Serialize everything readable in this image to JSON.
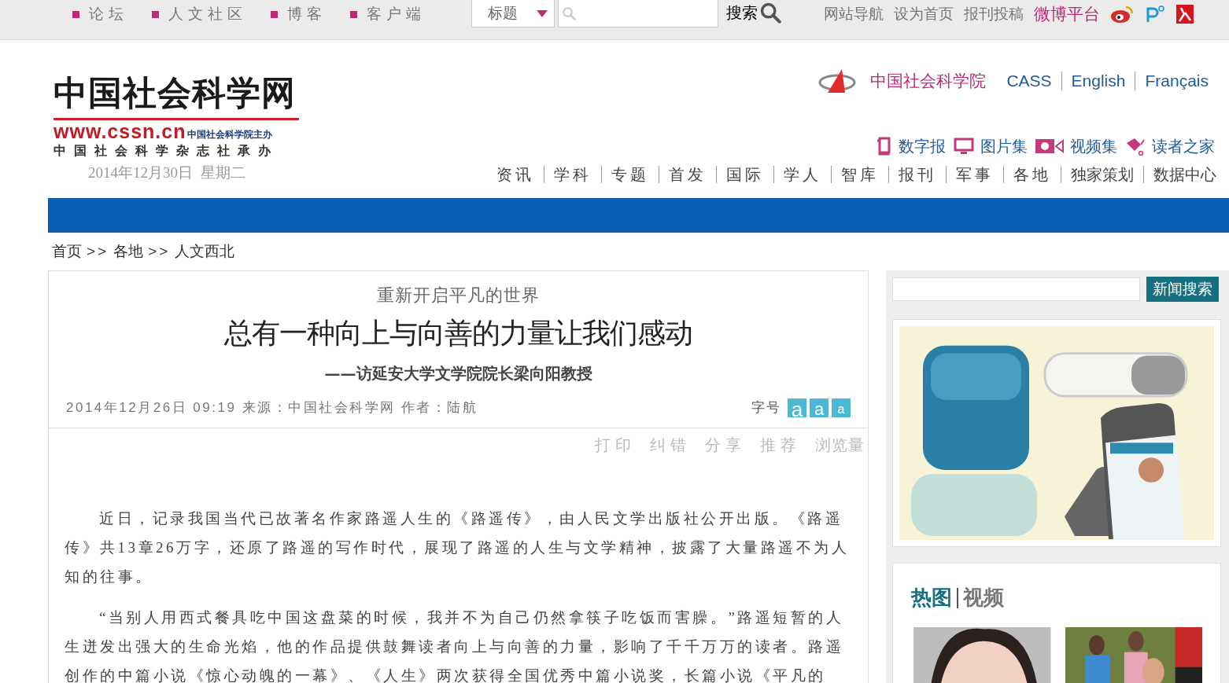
{
  "top_bar": {
    "links": [
      {
        "text": "论坛"
      },
      {
        "text": "人文社区"
      },
      {
        "text": "博客"
      },
      {
        "text": "客户端"
      }
    ],
    "search": {
      "scope": "标题",
      "button": "搜索"
    },
    "right_links": [
      {
        "text": "网站导航",
        "kind": "plain"
      },
      {
        "text": "设为首页",
        "kind": "plain"
      },
      {
        "text": "报刊投稿",
        "kind": "plain"
      },
      {
        "text": "微博平台",
        "kind": "accent"
      }
    ]
  },
  "header": {
    "logo": {
      "title": "中国社会科学网",
      "url": "www.cssn.cn",
      "host": "中国社会科学院主办",
      "publisher": "中国社会科学杂志社承办"
    },
    "date": "2014年12月30日  星期二",
    "org_link": "中国社会科学院",
    "languages": [
      "CASS",
      "English",
      "Français"
    ],
    "quick_links": [
      {
        "text": "数字报",
        "kind": "paper"
      },
      {
        "text": "图片集",
        "kind": "monitor"
      },
      {
        "text": "视频集",
        "kind": "video"
      },
      {
        "text": "读者之家",
        "kind": "reader"
      }
    ],
    "nav": [
      "资讯",
      "学科",
      "专题",
      "首发",
      "国际",
      "学人",
      "智库",
      "报刊",
      "军事",
      "各地",
      "独家策划",
      "数据中心"
    ]
  },
  "breadcrumb": [
    {
      "kind": "link",
      "text": "首页"
    },
    {
      "kind": "sep",
      "text": ">>"
    },
    {
      "kind": "link",
      "text": "各地"
    },
    {
      "kind": "sep",
      "text": ">>"
    },
    {
      "kind": "link",
      "text": "人文西北"
    }
  ],
  "article": {
    "kicker": "重新开启平凡的世界",
    "title": "总有一种向上与向善的力量让我们感动",
    "subtitle": "——访延安大学文学院院长梁向阳教授",
    "meta": "2014年12月26日 09:19 来源：中国社会科学网 作者：陆航",
    "font_size": {
      "label": "字号",
      "buttons": [
        "a",
        "a",
        "a"
      ]
    },
    "tools": [
      "打印",
      "纠错",
      "分享",
      "推荐",
      "浏览量"
    ],
    "paragraphs": [
      "近日，记录我国当代已故著名作家路遥人生的《路遥传》，由人民文学出版社公开出版。《路遥传》共13章26万字，还原了路遥的写作时代，展现了路遥的人生与文学精神，披露了大量路遥不为人知的往事。",
      "“当别人用西式餐具吃中国这盘菜的时候，我并不为自己仍然拿筷子吃饭而害臊。”路遥短暂的人生迸发出强大的生命光焰，他的作品提供鼓舞读者向上与向善的力量，影响了千千万万的读者。路遥创作的中篇小说《惊心动魄的一幕》、《人生》两次获得全国优秀中篇小说奖，长篇小说《平凡的"
    ]
  },
  "sidebar": {
    "search_button": "新闻搜索",
    "media": {
      "tabs": [
        {
          "text": "热图",
          "selected": true
        },
        {
          "text": "视频",
          "selected": false
        }
      ]
    }
  }
}
